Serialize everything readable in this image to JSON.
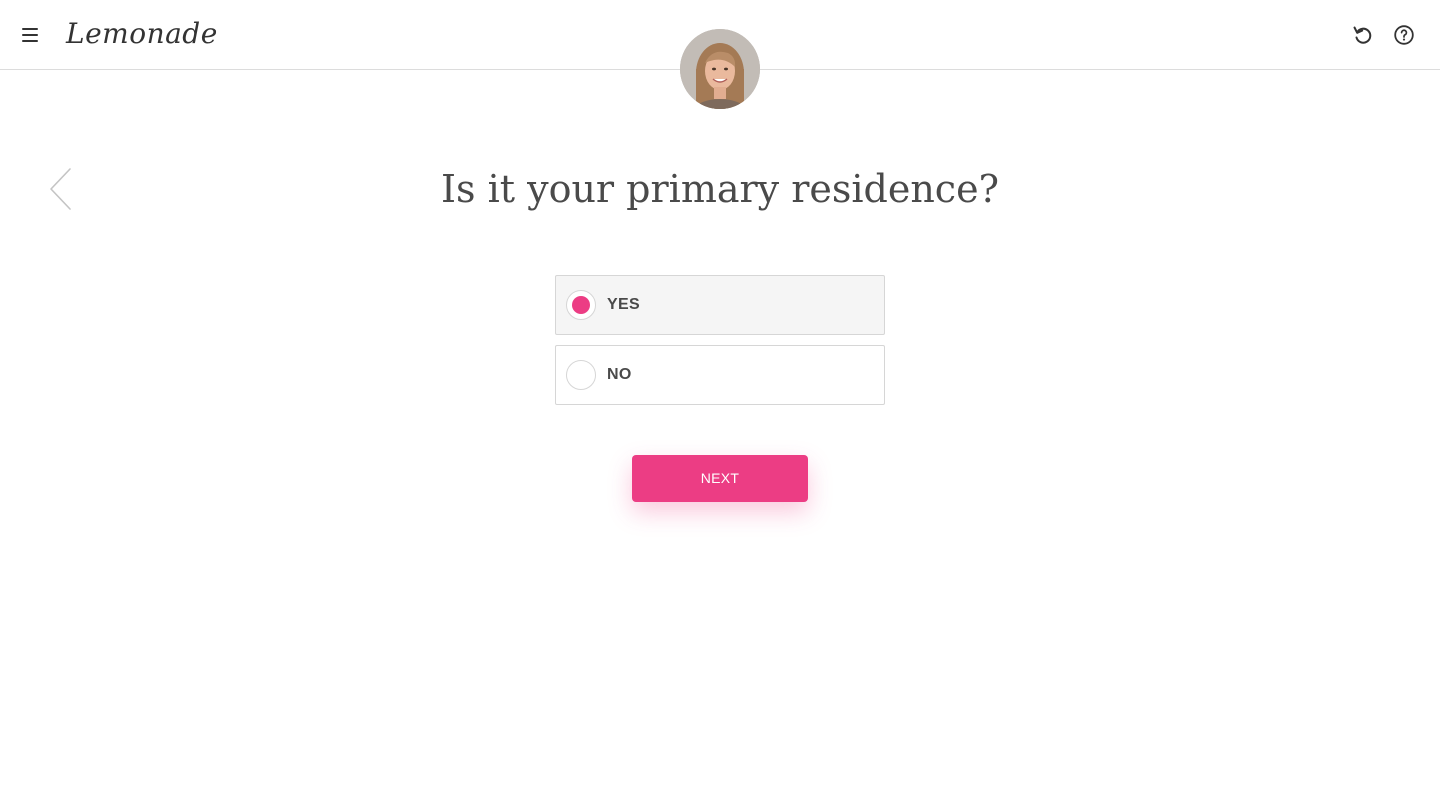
{
  "header": {
    "logo_text": "Lemonade",
    "menu_icon": "hamburger-menu-icon",
    "restart_icon": "restart-icon",
    "help_icon": "help-icon"
  },
  "assistant": {
    "avatar_icon": "assistant-avatar"
  },
  "navigation": {
    "back_icon": "chevron-left-icon"
  },
  "question": {
    "text": "Is it your primary residence?"
  },
  "options": [
    {
      "label": "YES",
      "selected": true
    },
    {
      "label": "NO",
      "selected": false
    }
  ],
  "next_button": {
    "label": "NEXT"
  },
  "colors": {
    "accent": "#ec3d84",
    "text": "#4a4a4a",
    "border": "#d6d6d6",
    "selected_bg": "#f5f5f5"
  }
}
